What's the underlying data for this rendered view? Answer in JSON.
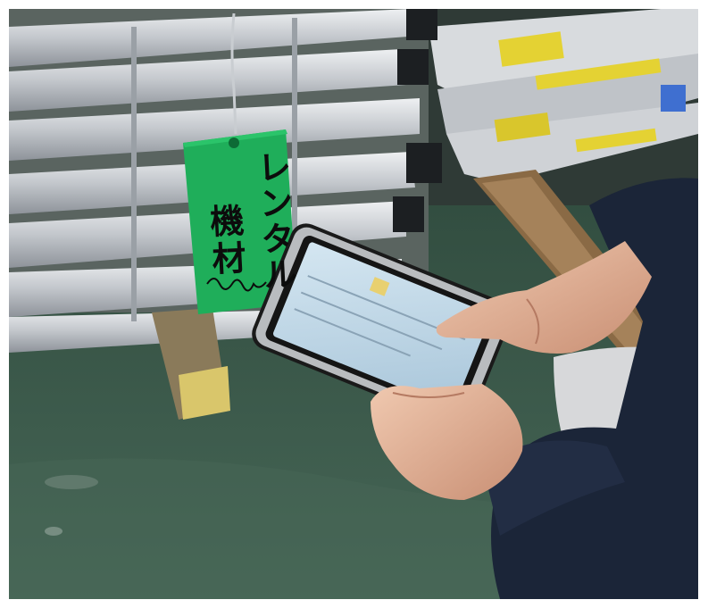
{
  "photo": {
    "tag": {
      "line1": "レンタル",
      "line2": "機材",
      "handwritten": "R/IC3"
    },
    "colors": {
      "tag_green": "#1fae5a",
      "floor_green": "#3c5a4a",
      "rail_aluminum": "#c9ccd0",
      "wood_block": "#d9c66b",
      "tablet_screen": "#bcd6e6",
      "jacket_navy": "#1b2538",
      "pants_gray": "#d7d8da"
    }
  }
}
